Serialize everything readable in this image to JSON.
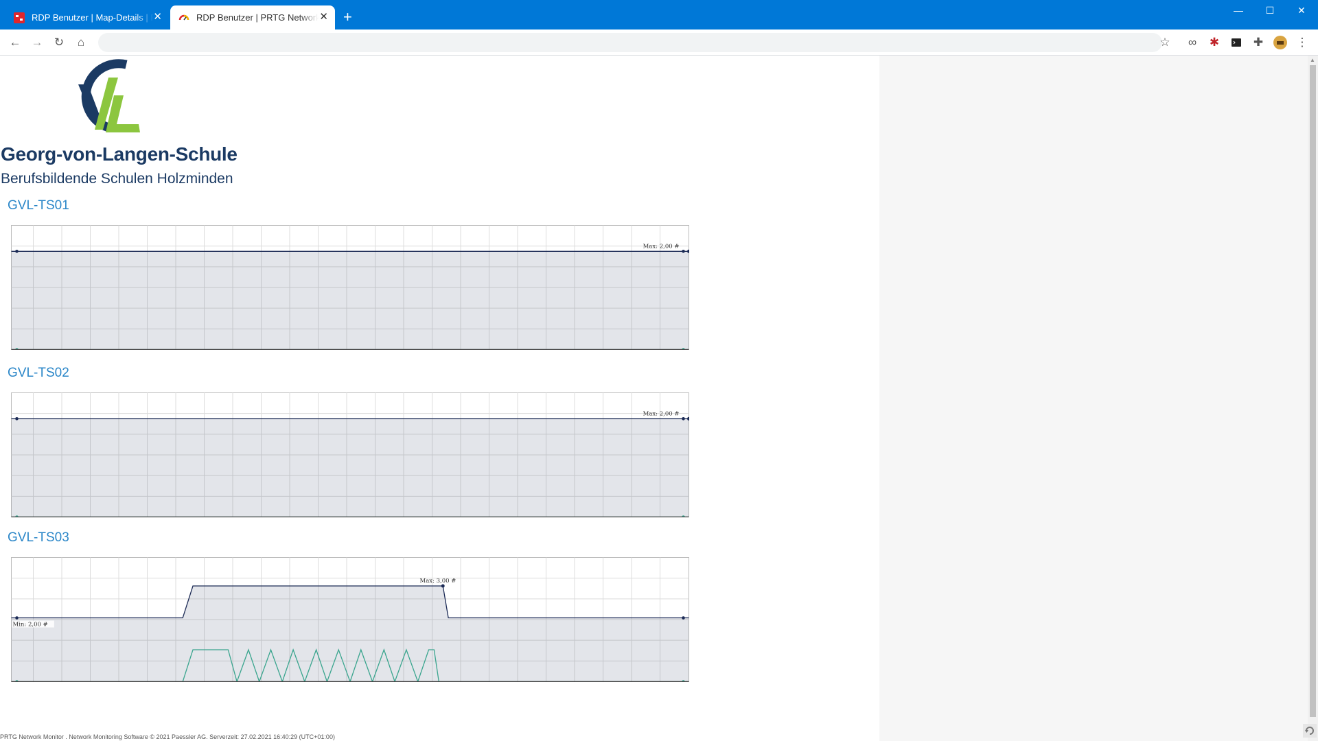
{
  "browser": {
    "tabs": [
      {
        "title": "RDP Benutzer | Map-Details | PRTG Network Monitor",
        "active": false
      },
      {
        "title": "RDP Benutzer | PRTG Network Monitor",
        "active": true
      }
    ],
    "new_tab": "+",
    "window_controls": {
      "minimize": "—",
      "maximize": "☐",
      "close": "✕"
    },
    "accent": "#0078d7"
  },
  "page": {
    "logo_letters": "GVL",
    "school_name": "Georg-von-Langen-Schule",
    "school_sub": "Berufsbildende Schulen Holzminden",
    "footer": "PRTG Network Monitor . Network Monitoring Software © 2021 Paessler AG. Serverzeit: 27.02.2021 16:40:29 (UTC+01:00)"
  },
  "chart_data": [
    {
      "name": "GVL-TS01",
      "type": "line",
      "ylim": [
        0,
        2.5
      ],
      "x": [
        0,
        1
      ],
      "series": [
        {
          "values": [
            2,
            2
          ],
          "color": "#1b2a55",
          "fill": true
        },
        {
          "values": [
            0,
            0
          ],
          "color": "#3aa58e"
        }
      ],
      "annotations": [
        {
          "label": "Max: 2,00 #",
          "x": 1,
          "y": 2
        }
      ]
    },
    {
      "name": "GVL-TS02",
      "type": "line",
      "ylim": [
        0,
        2.5
      ],
      "x": [
        0,
        1
      ],
      "series": [
        {
          "values": [
            2,
            2
          ],
          "color": "#1b2a55",
          "fill": true
        },
        {
          "values": [
            0,
            0
          ],
          "color": "#3aa58e"
        }
      ],
      "annotations": [
        {
          "label": "Max: 2,00 #",
          "x": 1,
          "y": 2
        }
      ]
    },
    {
      "name": "GVL-TS03",
      "type": "line",
      "ylim": [
        0,
        3.85
      ],
      "x": [
        0,
        0.253,
        0.268,
        0.637,
        0.645,
        1
      ],
      "series": [
        {
          "values": [
            2,
            2,
            3,
            3,
            2,
            2
          ],
          "color": "#1b2a55",
          "fill": true
        },
        {
          "x": [
            0,
            0.253,
            0.268,
            0.32,
            0.333,
            0.35,
            0.366,
            0.383,
            0.4,
            0.416,
            0.433,
            0.45,
            0.466,
            0.483,
            0.5,
            0.516,
            0.533,
            0.55,
            0.566,
            0.583,
            0.6,
            0.616,
            0.624,
            0.631,
            1
          ],
          "values": [
            0,
            0,
            1,
            1,
            0,
            1,
            0,
            1,
            0,
            1,
            0,
            1,
            0,
            1,
            0,
            1,
            0,
            1,
            0,
            1,
            0,
            1,
            1,
            0,
            0
          ],
          "color": "#3aa58e"
        }
      ],
      "annotations": [
        {
          "label": "Max: 3,00 #",
          "x": 0.637,
          "y": 3
        },
        {
          "label": "Min: 2,00 #",
          "x": 0,
          "y": 2
        }
      ]
    }
  ]
}
